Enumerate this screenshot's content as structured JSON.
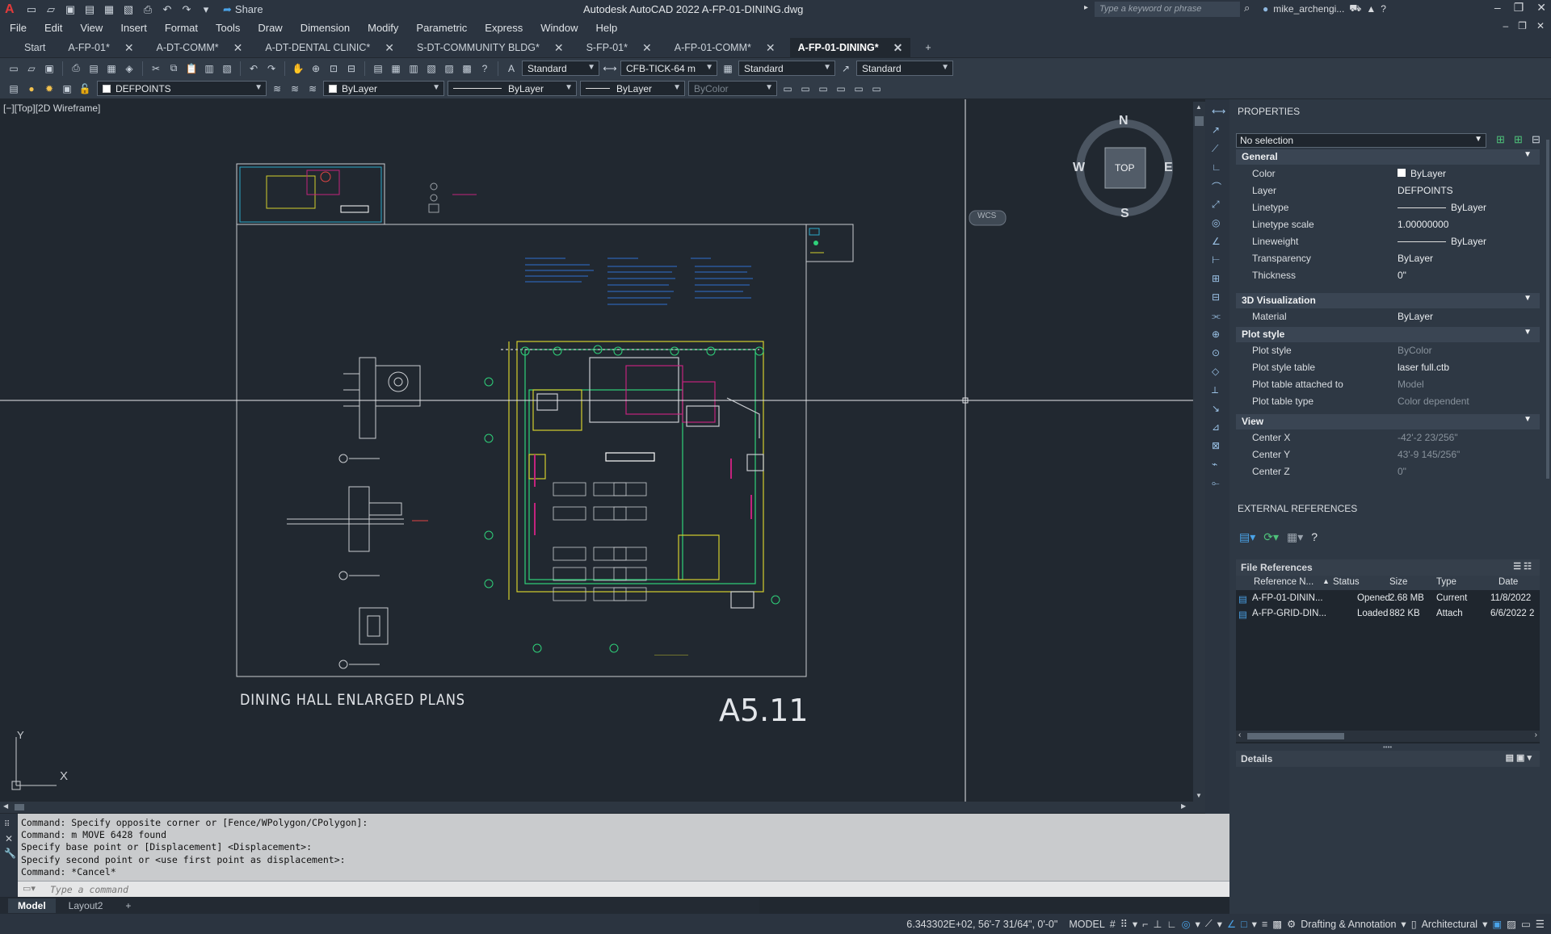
{
  "titlebar": {
    "app_title": "Autodesk AutoCAD 2022   A-FP-01-DINING.dwg",
    "share_label": "Share",
    "search_placeholder": "Type a keyword or phrase",
    "username": "mike_archengi..."
  },
  "menu": [
    "File",
    "Edit",
    "View",
    "Insert",
    "Format",
    "Tools",
    "Draw",
    "Dimension",
    "Modify",
    "Parametric",
    "Express",
    "Window",
    "Help"
  ],
  "tabs": [
    {
      "label": "Start",
      "active": false,
      "closable": false
    },
    {
      "label": "A-FP-01*",
      "active": false,
      "closable": true
    },
    {
      "label": "A-DT-COMM*",
      "active": false,
      "closable": true
    },
    {
      "label": "A-DT-DENTAL CLINIC*",
      "active": false,
      "closable": true
    },
    {
      "label": "S-DT-COMMUNITY BLDG*",
      "active": false,
      "closable": true
    },
    {
      "label": "S-FP-01*",
      "active": false,
      "closable": true
    },
    {
      "label": "A-FP-01-COMM*",
      "active": false,
      "closable": true
    },
    {
      "label": "A-FP-01-DINING*",
      "active": true,
      "closable": true
    }
  ],
  "toolbar1": {
    "text_style": "Standard",
    "dim_style": "CFB-TICK-64 m",
    "table_style": "Standard",
    "mleader_style": "Standard"
  },
  "toolbar2": {
    "layer": "DEFPOINTS",
    "color": "ByLayer",
    "linetype": "ByLayer",
    "lineweight": "ByLayer",
    "plotstyle": "ByColor"
  },
  "viewport": {
    "label": "[−][Top][2D Wireframe]",
    "drawing_title": "DINING HALL ENLARGED PLANS",
    "sheet_number": "A5.11",
    "viewcube": {
      "n": "N",
      "s": "S",
      "e": "E",
      "w": "W",
      "face": "TOP",
      "wcs": "WCS"
    },
    "ucs_x": "X",
    "ucs_y": "Y"
  },
  "command": {
    "history": [
      "Command: Specify opposite corner or [Fence/WPolygon/CPolygon]:",
      "Command: m MOVE 6428 found",
      "Specify base point or [Displacement] <Displacement>:",
      "Specify second point or <use first point as displacement>:",
      "Command: *Cancel*"
    ],
    "placeholder": "Type a command"
  },
  "layout_tabs": [
    "Model",
    "Layout2"
  ],
  "status": {
    "coords": "6.343302E+02, 56'-7 31/64\", 0'-0\"",
    "mode": "MODEL",
    "workspace": "Drafting & Annotation",
    "units": "Architectural"
  },
  "properties": {
    "title": "PROPERTIES",
    "selection": "No selection",
    "general_title": "General",
    "general": [
      {
        "k": "Color",
        "v": "ByLayer"
      },
      {
        "k": "Layer",
        "v": "DEFPOINTS"
      },
      {
        "k": "Linetype",
        "v": "ByLayer"
      },
      {
        "k": "Linetype scale",
        "v": "1.00000000"
      },
      {
        "k": "Lineweight",
        "v": "ByLayer"
      },
      {
        "k": "Transparency",
        "v": "ByLayer"
      },
      {
        "k": "Thickness",
        "v": "0\""
      }
    ],
    "viz_title": "3D Visualization",
    "viz": [
      {
        "k": "Material",
        "v": "ByLayer"
      }
    ],
    "plot_title": "Plot style",
    "plot": [
      {
        "k": "Plot style",
        "v": "ByColor"
      },
      {
        "k": "Plot style table",
        "v": "laser full.ctb"
      },
      {
        "k": "Plot table attached to",
        "v": "Model"
      },
      {
        "k": "Plot table type",
        "v": "Color dependent"
      }
    ],
    "view_title": "View",
    "view": [
      {
        "k": "Center X",
        "v": "-42'-2 23/256\""
      },
      {
        "k": "Center Y",
        "v": "43'-9 145/256\""
      },
      {
        "k": "Center Z",
        "v": "0\""
      }
    ]
  },
  "xref": {
    "title": "EXTERNAL REFERENCES",
    "file_refs_title": "File References",
    "columns": [
      "Reference N...",
      "Status",
      "Size",
      "Type",
      "Date"
    ],
    "rows": [
      [
        "A-FP-01-DININ...",
        "Opened",
        "2.68 MB",
        "Current",
        "11/8/2022"
      ],
      [
        "A-FP-GRID-DIN...",
        "Loaded",
        "882 KB",
        "Attach",
        "6/6/2022 2"
      ]
    ],
    "details_title": "Details"
  }
}
